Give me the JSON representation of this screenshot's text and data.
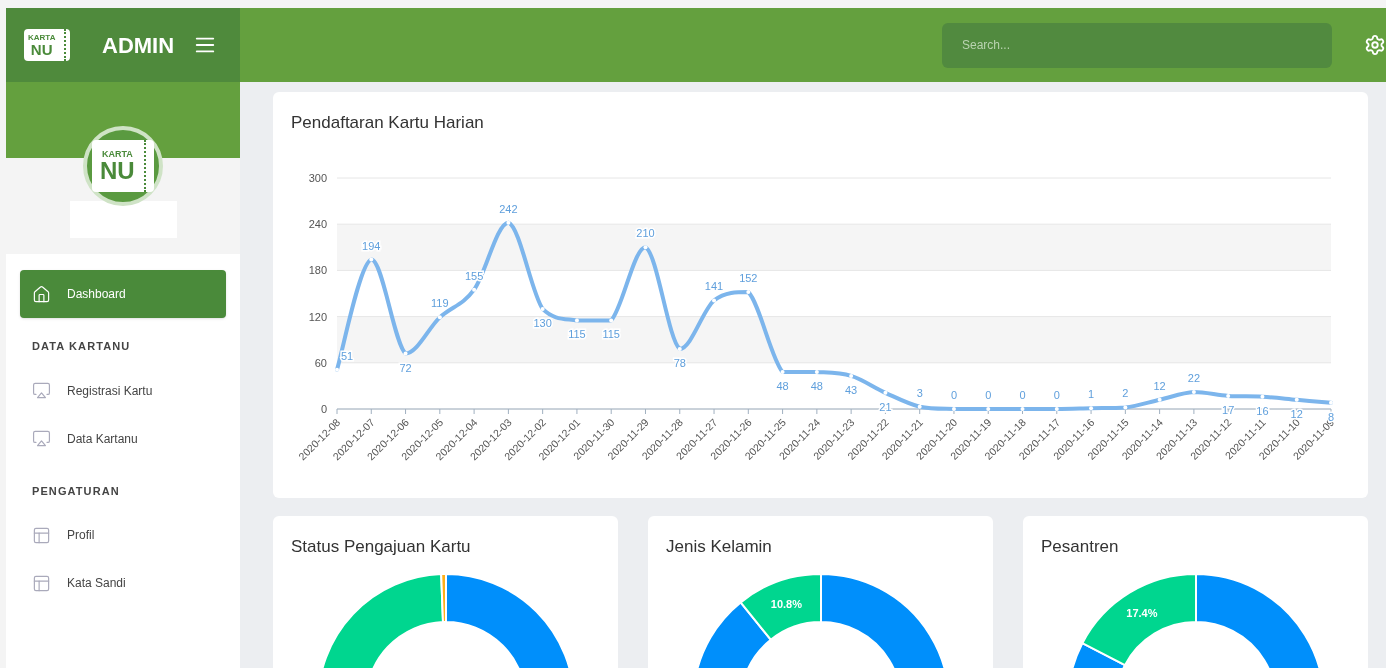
{
  "header": {
    "logo": {
      "small": "KARTA",
      "big": "NU"
    },
    "title": "ADMIN",
    "search": {
      "placeholder": "Search..."
    }
  },
  "sidebar": {
    "profile_logo": {
      "small": "KARTA",
      "big": "NU"
    },
    "items": [
      {
        "kind": "home",
        "label": "Dashboard",
        "selected": true
      }
    ],
    "sections": [
      {
        "title": "DATA KARTANU",
        "items": [
          {
            "kind": "screen",
            "label": "Registrasi Kartu",
            "selected": false
          },
          {
            "kind": "screen",
            "label": "Data Kartanu",
            "selected": false
          }
        ]
      },
      {
        "title": "PENGATURAN",
        "items": [
          {
            "kind": "layout",
            "label": "Profil",
            "selected": false
          },
          {
            "kind": "layout",
            "label": "Kata Sandi",
            "selected": false
          }
        ]
      }
    ]
  },
  "daily_chart": {
    "title": "Pendaftaran Kartu Harian",
    "chart_data": {
      "type": "line",
      "categories": [
        "2020-12-08",
        "2020-12-07",
        "2020-12-06",
        "2020-12-05",
        "2020-12-04",
        "2020-12-03",
        "2020-12-02",
        "2020-12-01",
        "2020-11-30",
        "2020-11-29",
        "2020-11-28",
        "2020-11-27",
        "2020-11-26",
        "2020-11-25",
        "2020-11-24",
        "2020-11-23",
        "2020-11-22",
        "2020-11-21",
        "2020-11-20",
        "2020-11-19",
        "2020-11-18",
        "2020-11-17",
        "2020-11-16",
        "2020-11-15",
        "2020-11-14",
        "2020-11-13",
        "2020-11-12",
        "2020-11-11",
        "2020-11-10",
        "2020-11-09"
      ],
      "series": [
        {
          "color": "#7cb5ec",
          "values": [
            51,
            194,
            72,
            119,
            155,
            242,
            130,
            115,
            115,
            210,
            78,
            141,
            152,
            48,
            48,
            43,
            21,
            3,
            0,
            0,
            0,
            0,
            1,
            2,
            12,
            22,
            17,
            16,
            12,
            8
          ]
        }
      ],
      "ylim": [
        0,
        300
      ],
      "yticks": [
        0,
        60,
        120,
        180,
        240,
        300
      ],
      "grid": true,
      "data_labels": true
    }
  },
  "donuts": [
    {
      "title": "Status Pengajuan Kartu",
      "chart_data": {
        "type": "donut",
        "values": [
          50.0,
          49.4,
          0.6
        ],
        "colors": [
          "#008ffb",
          "#00d68f",
          "#feb019"
        ]
      }
    },
    {
      "title": "Jenis Kelamin",
      "chart_data": {
        "type": "donut",
        "values": [
          65.0,
          24.2,
          10.8
        ],
        "colors": [
          "#008ffb",
          "#008ffb",
          "#00d68f"
        ],
        "value_labels": [
          null,
          null,
          "10.8%"
        ]
      }
    },
    {
      "title": "Pesantren",
      "chart_data": {
        "type": "donut",
        "values": [
          65.0,
          17.6,
          17.4
        ],
        "colors": [
          "#008ffb",
          "#008ffb",
          "#00d68f"
        ],
        "value_labels": [
          null,
          null,
          "17.4%"
        ]
      }
    }
  ]
}
